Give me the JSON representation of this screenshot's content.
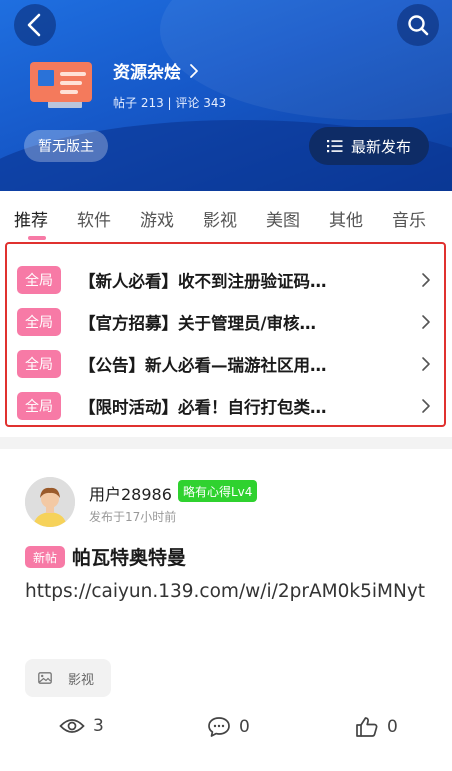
{
  "header": {
    "forum_name": "资源杂烩",
    "stats": "帖子 213 | 评论 343",
    "no_moderator": "暂无版主",
    "latest_button": "最新发布"
  },
  "tabs": [
    "推荐",
    "软件",
    "游戏",
    "影视",
    "美图",
    "其他",
    "音乐"
  ],
  "active_tab": "推荐",
  "pinned": [
    {
      "badge": "全局",
      "title": "【新人必看】收不到注册验证码…"
    },
    {
      "badge": "全局",
      "title": "【官方招募】关于管理员/审核…"
    },
    {
      "badge": "全局",
      "title": "【公告】新人必看—瑞游社区用…"
    },
    {
      "badge": "全局",
      "title": "【限时活动】必看！自行打包类…"
    }
  ],
  "post": {
    "username": "用户28986",
    "level": "略有心得Lv4",
    "time": "发布于17小时前",
    "new_badge": "新帖",
    "title": "帕瓦特奥特曼",
    "body": "https://caiyun.139.com/w/i/2prAM0k5iMNyt",
    "tag": "影视",
    "views": "3",
    "comments": "0",
    "likes": "0"
  },
  "colors": {
    "header_blue": "#1658c8",
    "accent_pink": "#f77aa6",
    "highlight_red": "#e0312f",
    "level_green": "#2fd22f"
  }
}
